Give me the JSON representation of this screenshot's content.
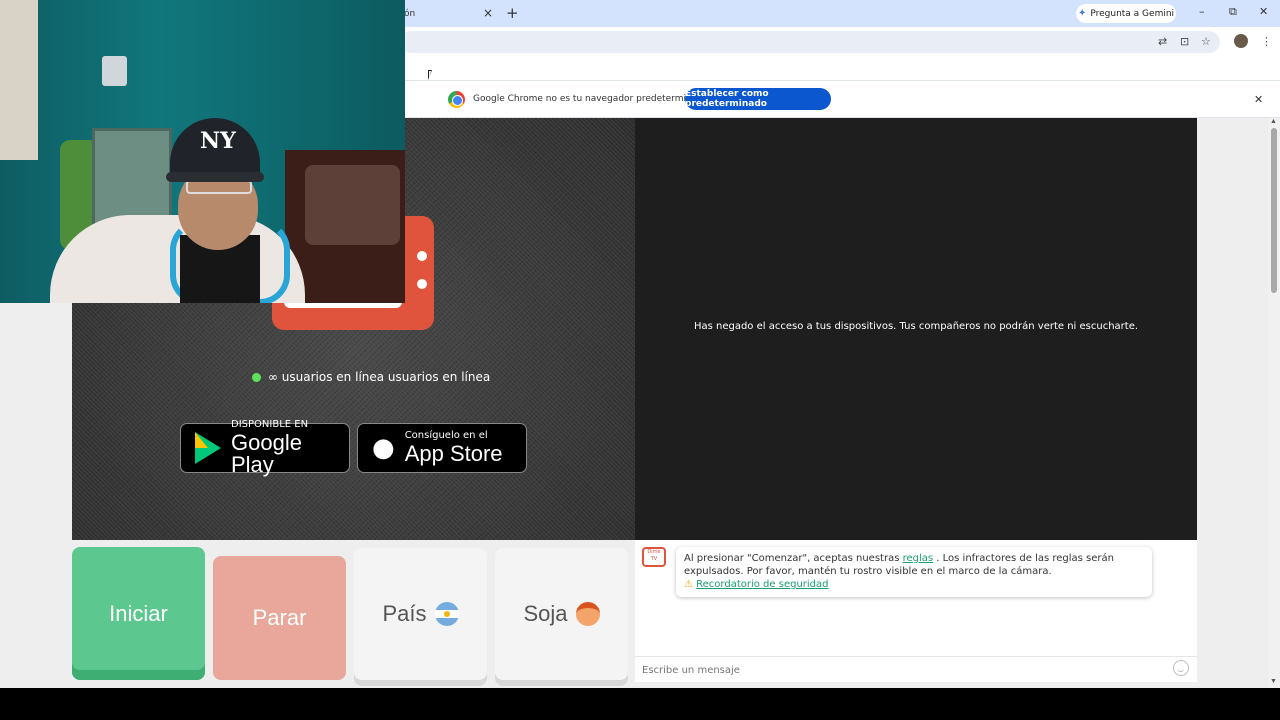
{
  "browser": {
    "tab_title": "ón",
    "tab_close": "×",
    "new_tab": "+",
    "gemini_button": "Pregunta a Gemini",
    "window_controls": [
      "–",
      "⧉",
      "✕"
    ],
    "toolbar_icons": [
      "translate-icon",
      "install-icon",
      "star-icon",
      "profile-icon",
      "menu-icon"
    ],
    "infobar": {
      "message": "Google Chrome no es tu navegador predeterminado",
      "button": "Establecer como predeterminado",
      "close": "✕"
    }
  },
  "page": {
    "online_text": "∞ usuarios en línea usuarios en línea",
    "google_play": {
      "small": "DISPONIBLE EN",
      "big": "Google Play"
    },
    "app_store": {
      "small": "Consíguelo en el",
      "big": "App Store"
    },
    "denied_message": "Has negado el acceso a tus dispositivos. Tus compañeros no podrán verte ni escucharte.",
    "buttons": {
      "start": "Iniciar",
      "stop": "Parar",
      "country": "País",
      "gender": "Soja"
    },
    "chat": {
      "logo_text": "Dime TV",
      "msg_part1": "Al presionar \"Comenzar\", aceptas nuestras ",
      "msg_link": "reglas",
      "msg_part2": " . Los infractores de las reglas serán expulsados. Por favor, mantén tu rostro visible en el marco de la cámara.",
      "safety_link": "Recordatorio de seguridad",
      "input_placeholder": "Escribe un mensaje"
    }
  },
  "colors": {
    "start": "#5cc88f",
    "stop": "#e8a79a",
    "brand_red": "#e0533d",
    "chrome_blue": "#0b57d0"
  }
}
